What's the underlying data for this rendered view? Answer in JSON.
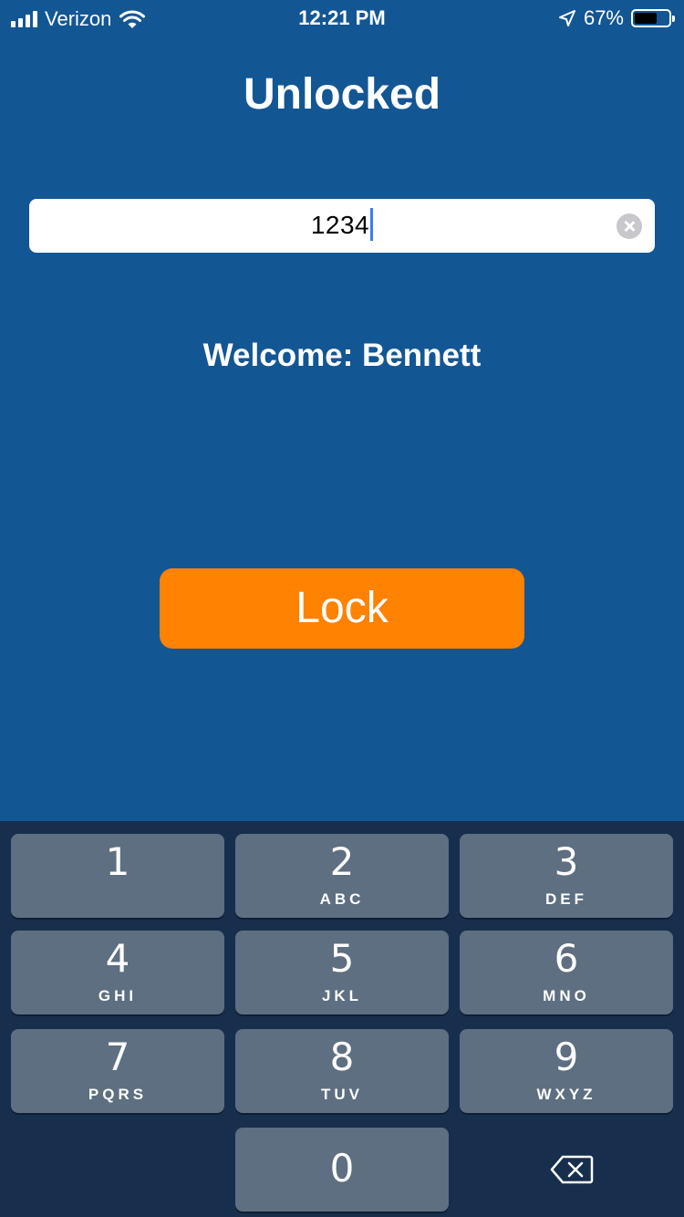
{
  "status_bar": {
    "carrier": "Verizon",
    "time": "12:21 PM",
    "battery": "67%",
    "battery_level": 0.67,
    "icons": [
      "cellular-signal-icon",
      "wifi-icon",
      "location-arrow-icon",
      "battery-icon"
    ]
  },
  "screen": {
    "title": "Unlocked"
  },
  "pin_field": {
    "value": "1234",
    "clear_icon": "clear-circle-icon"
  },
  "welcome_text": "Welcome: Bennett",
  "lock_button": {
    "label": "Lock"
  },
  "colors": {
    "background": "#135694",
    "accent": "#ff8200",
    "keypad_background": "#172f4d",
    "key": "#5d6f80"
  },
  "keypad": {
    "keys": [
      {
        "digit": "1",
        "letters": ""
      },
      {
        "digit": "2",
        "letters": "ABC"
      },
      {
        "digit": "3",
        "letters": "DEF"
      },
      {
        "digit": "4",
        "letters": "GHI"
      },
      {
        "digit": "5",
        "letters": "JKL"
      },
      {
        "digit": "6",
        "letters": "MNO"
      },
      {
        "digit": "7",
        "letters": "PQRS"
      },
      {
        "digit": "8",
        "letters": "TUV"
      },
      {
        "digit": "9",
        "letters": "WXYZ"
      },
      {
        "digit": "0",
        "letters": ""
      }
    ],
    "delete_icon": "backspace-icon"
  }
}
